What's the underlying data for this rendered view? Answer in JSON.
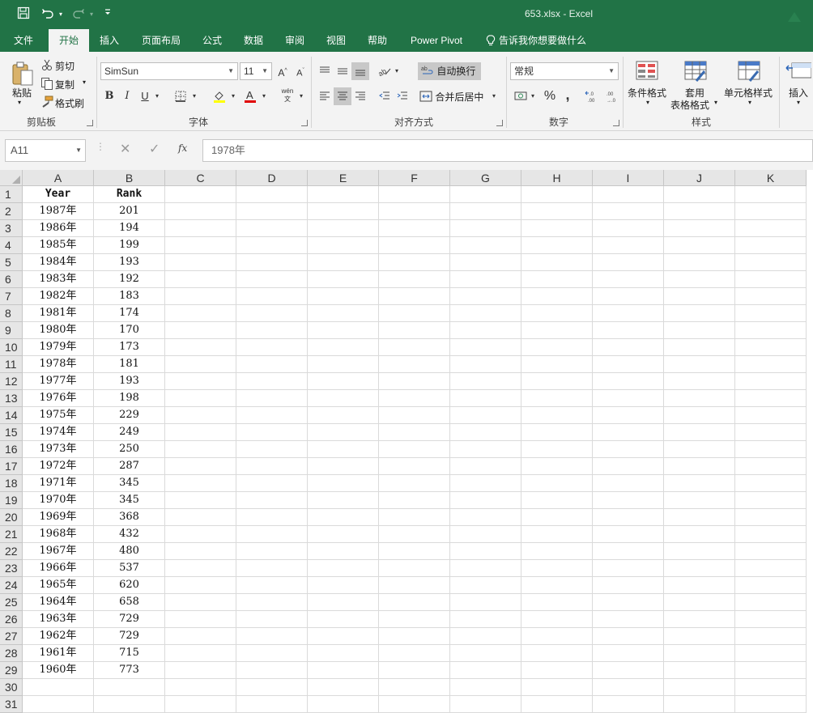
{
  "window": {
    "title": "653.xlsx  -  Excel",
    "quick_access": [
      "save-icon",
      "undo-icon",
      "redo-icon",
      "customize-icon"
    ]
  },
  "menu": {
    "tabs": [
      "文件",
      "开始",
      "插入",
      "页面布局",
      "公式",
      "数据",
      "审阅",
      "视图",
      "帮助",
      "Power Pivot",
      "告诉我你想要做什么"
    ],
    "active": "开始"
  },
  "ribbon": {
    "clipboard": {
      "label": "剪贴板",
      "paste": "粘贴",
      "cut": "剪切",
      "copy": "复制",
      "format_painter": "格式刷"
    },
    "font": {
      "label": "字体",
      "name": "SimSun",
      "size": "11",
      "bold": "B",
      "italic": "I",
      "underline": "U",
      "wen": "wén"
    },
    "alignment": {
      "label": "对齐方式",
      "wrap_text": "自动换行",
      "merge_center": "合并后居中"
    },
    "number": {
      "label": "数字",
      "format": "常规",
      "percent": "%",
      "comma": ","
    },
    "styles": {
      "label": "样式",
      "conditional": "条件格式",
      "table_format_1": "套用",
      "table_format_2": "表格格式",
      "cell_styles": "单元格样式"
    },
    "cells": {
      "insert": "插入"
    }
  },
  "formula_bar": {
    "name_box": "A11",
    "fx": "fx",
    "value": "1978年"
  },
  "grid": {
    "columns": [
      "A",
      "B",
      "C",
      "D",
      "E",
      "F",
      "G",
      "H",
      "I",
      "J",
      "K"
    ],
    "header_row": [
      "Year",
      "Rank"
    ],
    "rows": [
      [
        "1987年",
        "201"
      ],
      [
        "1986年",
        "194"
      ],
      [
        "1985年",
        "199"
      ],
      [
        "1984年",
        "193"
      ],
      [
        "1983年",
        "192"
      ],
      [
        "1982年",
        "183"
      ],
      [
        "1981年",
        "174"
      ],
      [
        "1980年",
        "170"
      ],
      [
        "1979年",
        "173"
      ],
      [
        "1978年",
        "181"
      ],
      [
        "1977年",
        "193"
      ],
      [
        "1976年",
        "198"
      ],
      [
        "1975年",
        "229"
      ],
      [
        "1974年",
        "249"
      ],
      [
        "1973年",
        "250"
      ],
      [
        "1972年",
        "287"
      ],
      [
        "1971年",
        "345"
      ],
      [
        "1970年",
        "345"
      ],
      [
        "1969年",
        "368"
      ],
      [
        "1968年",
        "432"
      ],
      [
        "1967年",
        "480"
      ],
      [
        "1966年",
        "537"
      ],
      [
        "1965年",
        "620"
      ],
      [
        "1964年",
        "658"
      ],
      [
        "1963年",
        "729"
      ],
      [
        "1962年",
        "729"
      ],
      [
        "1961年",
        "715"
      ],
      [
        "1960年",
        "773"
      ]
    ],
    "row_numbers": [
      "1",
      "2",
      "3",
      "4",
      "5",
      "6",
      "7",
      "8",
      "9",
      "10",
      "11",
      "12",
      "13",
      "14",
      "15",
      "16",
      "17",
      "18",
      "19",
      "20",
      "21",
      "22",
      "23",
      "24",
      "25",
      "26",
      "27",
      "28",
      "29",
      "30",
      "31"
    ]
  },
  "colors": {
    "brand": "#217346",
    "ribbon_bg": "#f3f3f3",
    "header_bg": "#e6e6e6"
  }
}
